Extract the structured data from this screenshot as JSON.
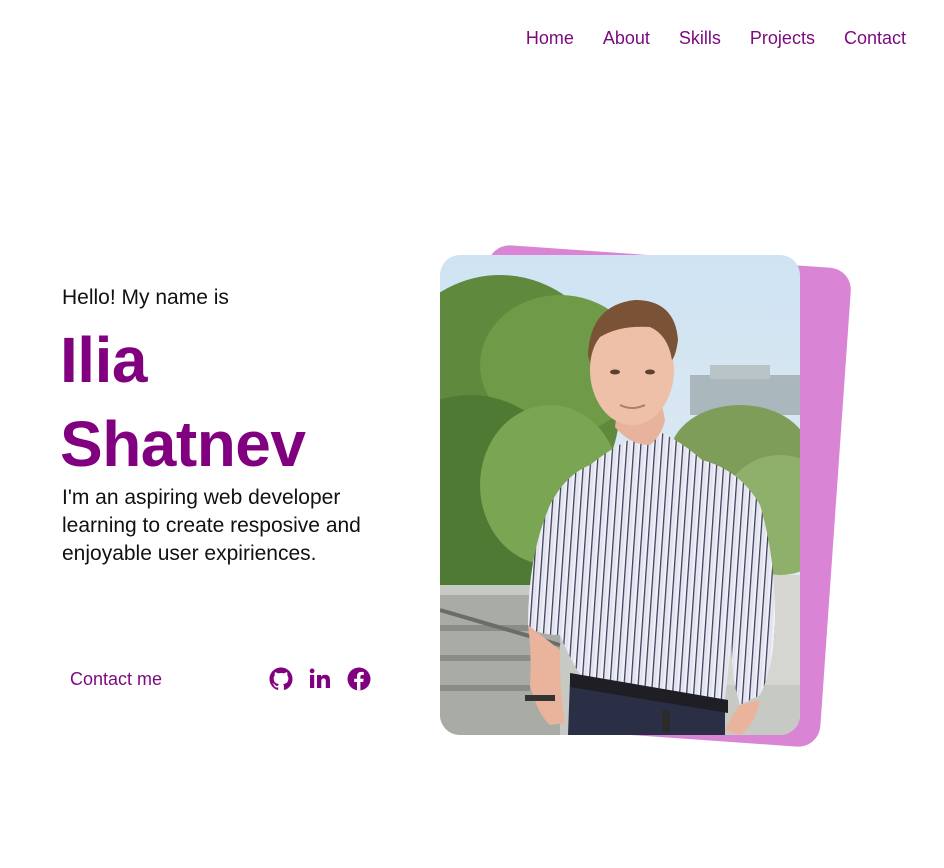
{
  "nav": {
    "items": [
      {
        "label": "Home"
      },
      {
        "label": "About"
      },
      {
        "label": "Skills"
      },
      {
        "label": "Projects"
      },
      {
        "label": "Contact"
      }
    ]
  },
  "hero": {
    "greeting": "Hello! My name is",
    "first_name": "Ilia",
    "last_name": "Shatnev",
    "tagline": "I'm an aspiring web developer learning to create resposive and enjoyable user expiriences.",
    "contact_label": "Contact me"
  },
  "socials": [
    {
      "icon": "github-icon"
    },
    {
      "icon": "linkedin-icon"
    },
    {
      "icon": "facebook-icon"
    }
  ],
  "colors": {
    "accent": "#800080",
    "photo_backdrop": "#da84d6"
  }
}
